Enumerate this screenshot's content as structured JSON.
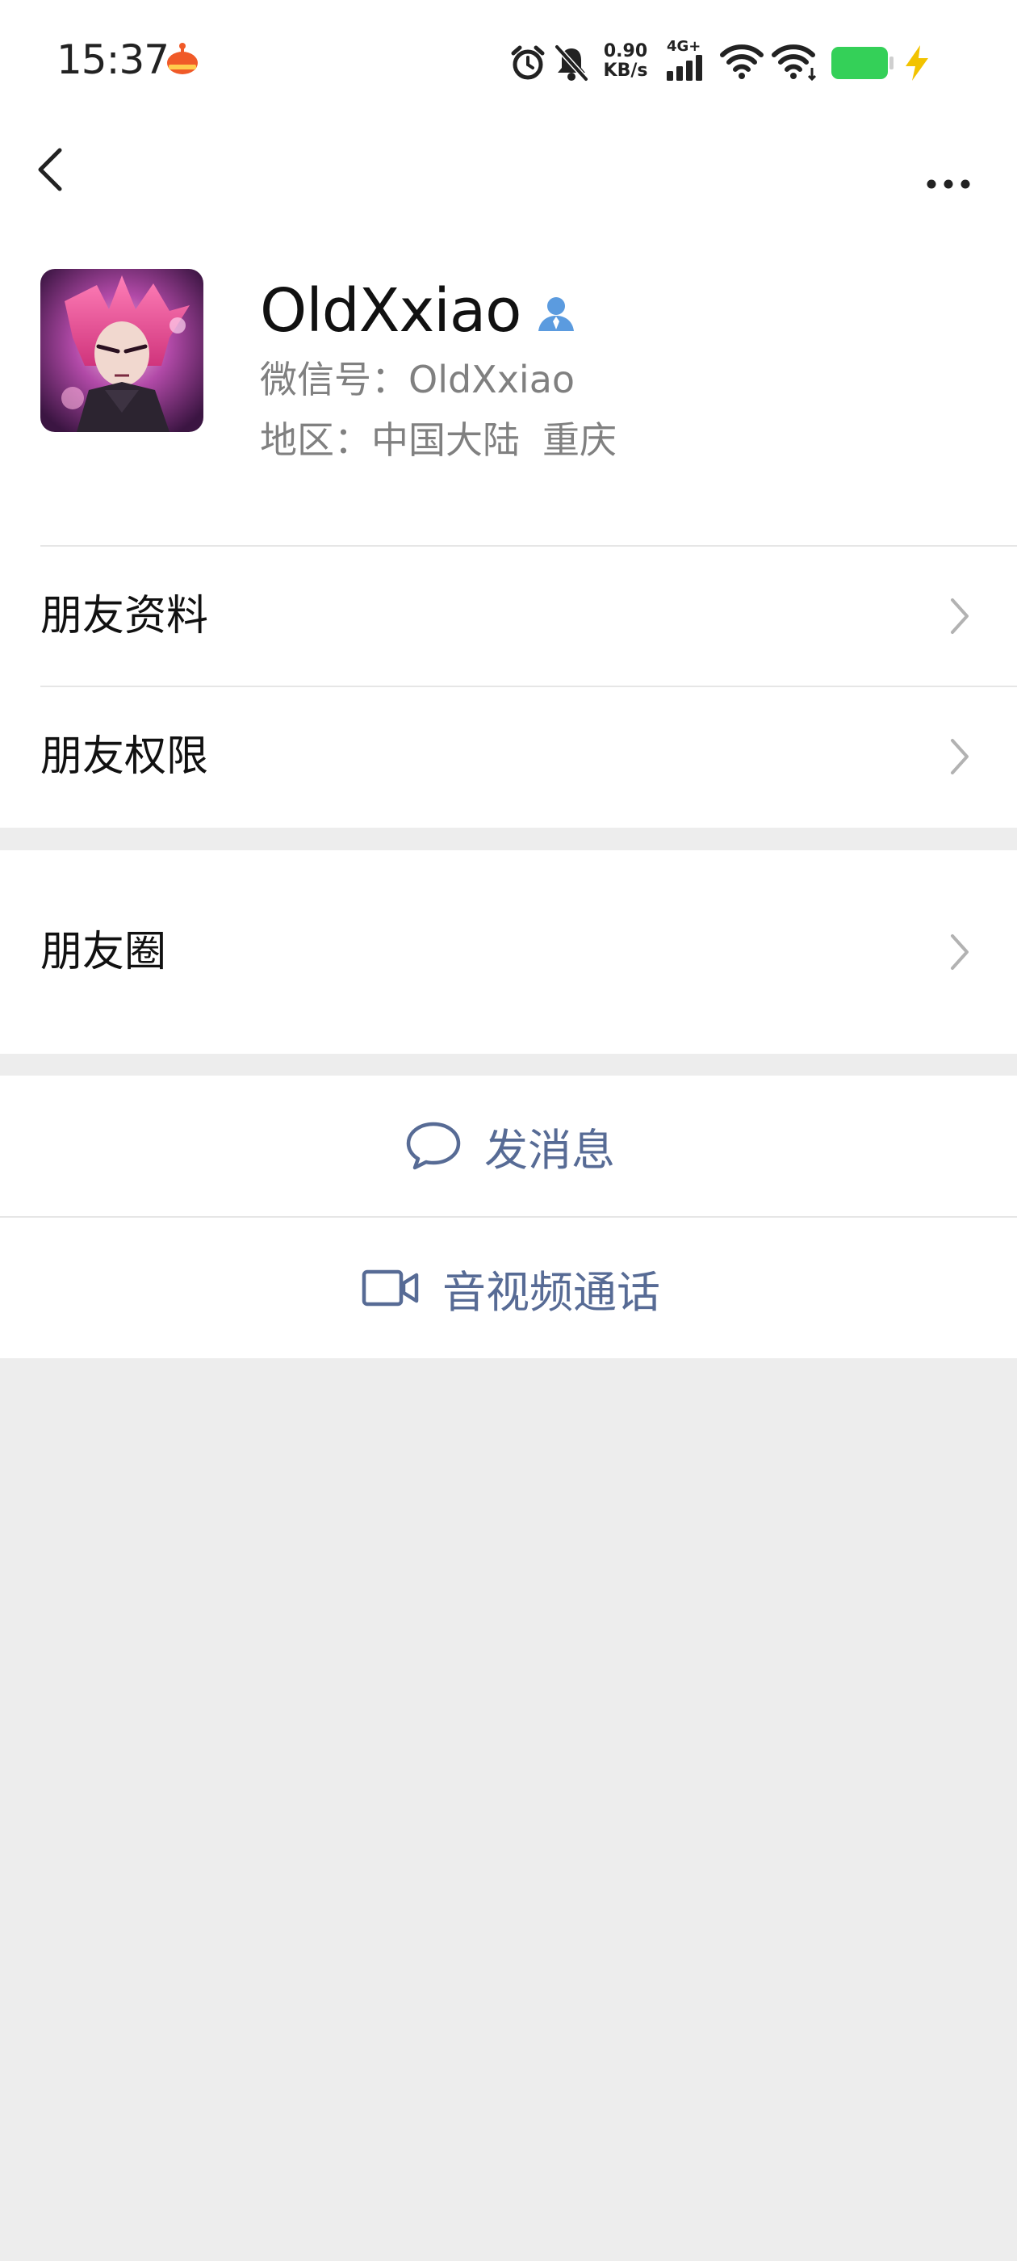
{
  "status_bar": {
    "time": "15:37",
    "net_speed_value": "0.90",
    "net_speed_unit": "KB/s",
    "network_type": "4G+",
    "battery_color": "#34d058",
    "charging_color": "#f2c300"
  },
  "nav": {
    "back_icon": "chevron-left-icon",
    "more_icon": "more-horizontal-icon"
  },
  "profile": {
    "nickname": "OldXxiao",
    "wechat_id": "微信号：OldXxiao",
    "region_label": "地区：",
    "region_country": "中国大陆",
    "region_city": "重庆"
  },
  "menu": {
    "friend_info": "朋友资料",
    "friend_permissions": "朋友权限",
    "moments": "朋友圈"
  },
  "actions": {
    "send_message": "发消息",
    "video_call": "音视频通话"
  },
  "colors": {
    "link_blue": "#576b95",
    "background": "#ededed",
    "secondary_text": "#808080",
    "badge_blue": "#5b9bdf"
  }
}
